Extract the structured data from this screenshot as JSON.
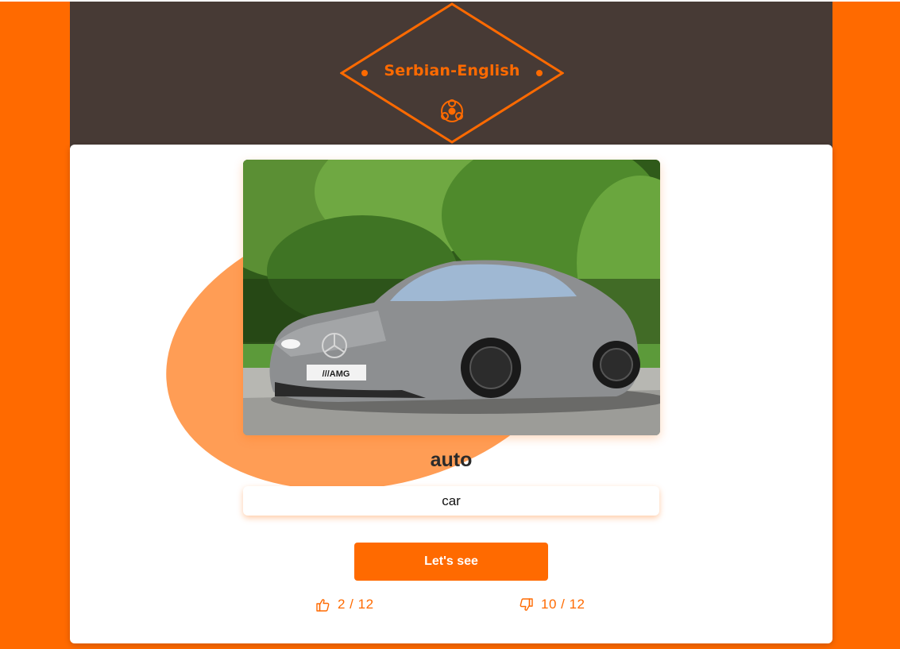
{
  "app": {
    "title": "Serbian-English",
    "logo_icon": "fidget-spinner-icon"
  },
  "colors": {
    "accent": "#ff6a00",
    "accent_light": "#ff9d55",
    "header_bg": "#473a35",
    "card_bg": "#ffffff"
  },
  "flashcard": {
    "image_alt": "Silver sports car parked in front of trees",
    "word": "auto",
    "answer_value": "car",
    "answer_placeholder": ""
  },
  "actions": {
    "check_label": "Let's see"
  },
  "stats": {
    "correct_icon": "thumbs-up-icon",
    "correct": "2 / 12",
    "wrong_icon": "thumbs-down-icon",
    "wrong": "10 / 12"
  }
}
